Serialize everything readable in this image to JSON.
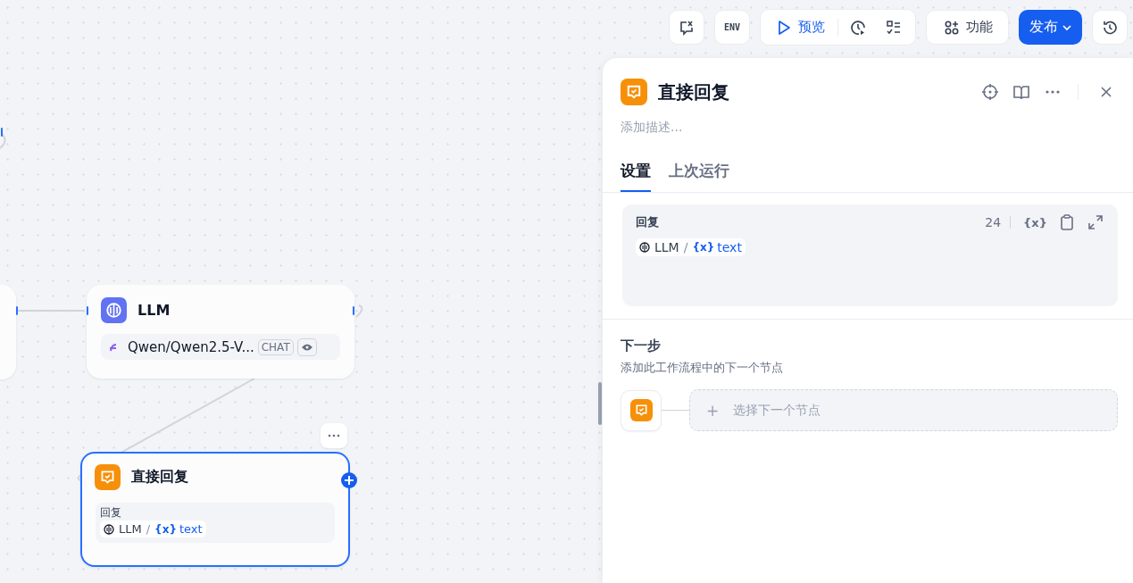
{
  "toolbar": {
    "env_button": "ENV",
    "preview_button": "预览",
    "features_button": "功能",
    "publish_button": "发布"
  },
  "canvas": {
    "nodes": [
      {
        "kind": "llm",
        "title": "LLM",
        "model": "Qwen/Qwen2.5-V...",
        "badge": "CHAT",
        "selected": false
      },
      {
        "kind": "answer",
        "title": "直接回复",
        "field_label": "回复",
        "ref_node": "LLM",
        "ref_sep": "/",
        "ref_var_mark": "{x}",
        "ref_var": "text",
        "selected": true
      }
    ]
  },
  "panel": {
    "title": "直接回复",
    "description_placeholder": "添加描述...",
    "tabs": [
      {
        "label": "设置",
        "selected": true
      },
      {
        "label": "上次运行",
        "selected": false
      }
    ],
    "reply": {
      "label": "回复",
      "count": "24",
      "var_button": "{x}",
      "ref_node": "LLM",
      "ref_sep": "/",
      "ref_var_mark": "{x}",
      "ref_var": "text"
    },
    "next_step": {
      "title": "下一步",
      "subtitle": "添加此工作流程中的下一个节点",
      "add_plus": "+",
      "add_label": "选择下一个节点"
    }
  }
}
